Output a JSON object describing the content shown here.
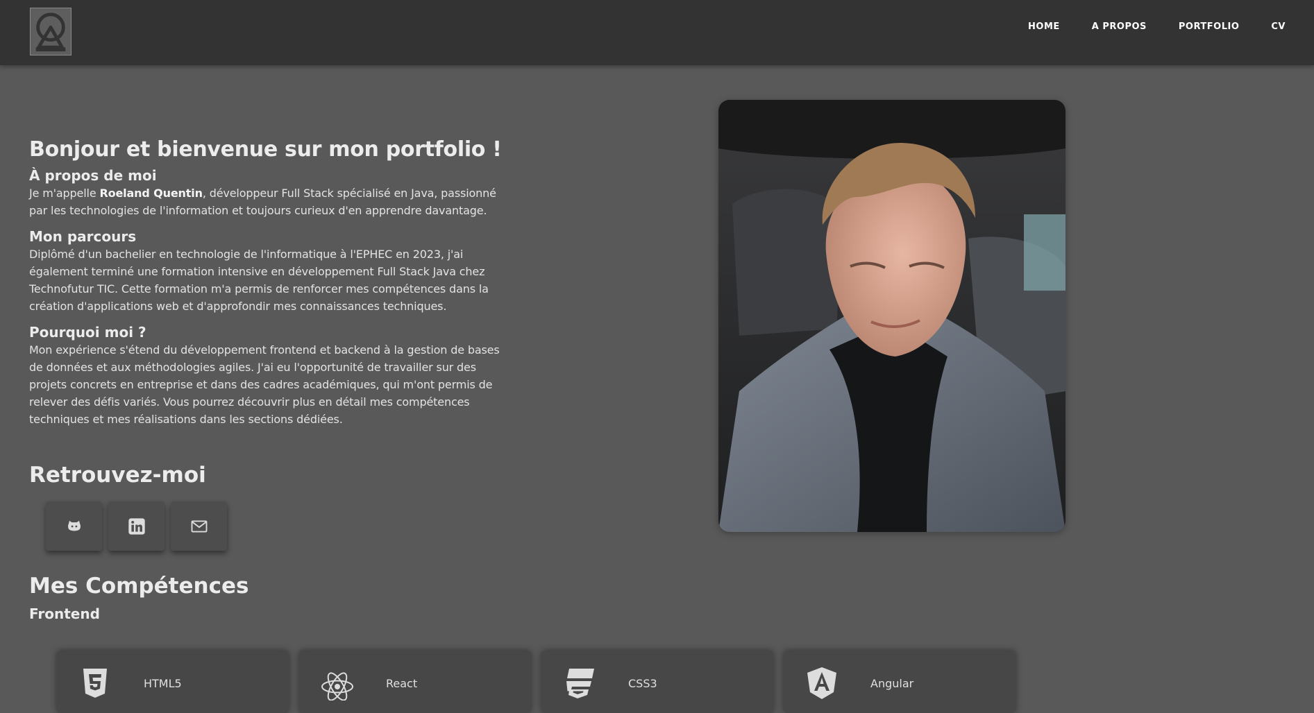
{
  "nav": {
    "items": [
      "HOME",
      "A PROPOS",
      "PORTFOLIO",
      "CV"
    ]
  },
  "hero": {
    "title": "Bonjour et bienvenue sur mon portfolio !",
    "about_heading": "À propos de moi",
    "about_prefix": "Je m'appelle ",
    "about_name": "Roeland Quentin",
    "about_suffix": ", développeur Full Stack spécialisé en Java, passionné par les technologies de l'information et toujours curieux d'en apprendre davantage.",
    "parcours_heading": "Mon parcours",
    "parcours_text": "Diplômé d'un bachelier en technologie de l'informatique à l'EPHEC en 2023, j'ai également terminé une formation intensive en développement Full Stack Java chez Technofutur TIC. Cette formation m'a permis de renforcer mes compétences dans la création d'applications web et d'approfondir mes connaissances techniques.",
    "pourquoi_heading": "Pourquoi moi ?",
    "pourquoi_text": "Mon expérience s'étend du développement frontend et backend à la gestion de bases de données et aux méthodologies agiles. J'ai eu l'opportunité de travailler sur des projets concrets en entreprise et dans des cadres académiques, qui m'ont permis de relever des défis variés. Vous pourrez découvrir plus en détail mes compétences techniques et mes réalisations dans les sections dédiées."
  },
  "contact": {
    "heading": "Retrouvez-moi",
    "links": [
      {
        "icon": "github-icon"
      },
      {
        "icon": "linkedin-icon"
      },
      {
        "icon": "mail-icon"
      }
    ]
  },
  "skills": {
    "heading": "Mes Compétences",
    "subheading": "Frontend",
    "cards": [
      {
        "label": "HTML5",
        "icon": "html5-icon"
      },
      {
        "label": "React",
        "icon": "react-icon"
      },
      {
        "label": "CSS3",
        "icon": "css3-icon"
      },
      {
        "label": "Angular",
        "icon": "angular-icon"
      }
    ]
  },
  "colors": {
    "page_bg": "#595959",
    "header_bg": "#333333",
    "card_bg": "#474747",
    "text": "#e6e6e6"
  }
}
